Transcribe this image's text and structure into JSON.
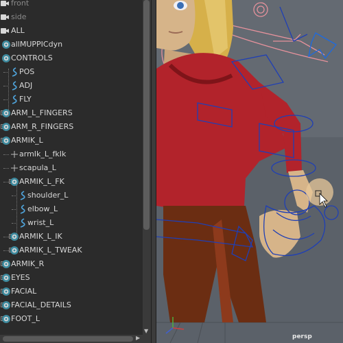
{
  "outliner": {
    "items": [
      {
        "label": "front",
        "icon": "camera-icon",
        "dim": true,
        "expander": ""
      },
      {
        "label": "side",
        "icon": "camera-icon",
        "dim": true,
        "expander": ""
      },
      {
        "label": "ALL",
        "icon": "camera-icon",
        "dim": false,
        "expander": ""
      },
      {
        "label": "allMUPPICdyn",
        "icon": "group-icon",
        "dim": false,
        "expander": ""
      },
      {
        "label": "CONTROLS",
        "icon": "group-icon",
        "dim": false,
        "expander": ""
      },
      {
        "label": "POS",
        "icon": "curve-icon",
        "dim": false,
        "expander": ""
      },
      {
        "label": "ADJ",
        "icon": "curve-icon",
        "dim": false,
        "expander": ""
      },
      {
        "label": "FLY",
        "icon": "curve-icon",
        "dim": false,
        "expander": ""
      },
      {
        "label": "ARM_L_FINGERS",
        "icon": "group-icon",
        "dim": false,
        "expander": "+"
      },
      {
        "label": "ARM_R_FINGERS",
        "icon": "group-icon",
        "dim": false,
        "expander": "+"
      },
      {
        "label": "ARMIK_L",
        "icon": "group-icon",
        "dim": false,
        "expander": "−"
      },
      {
        "label": "armIk_L_fkIk",
        "icon": "locator-icon",
        "dim": false,
        "expander": ""
      },
      {
        "label": "scapula_L",
        "icon": "locator-icon",
        "dim": false,
        "expander": ""
      },
      {
        "label": "ARMIK_L_FK",
        "icon": "group-icon",
        "dim": false,
        "expander": "−"
      },
      {
        "label": "shoulder_L",
        "icon": "curve-icon",
        "dim": false,
        "expander": ""
      },
      {
        "label": "elbow_L",
        "icon": "curve-icon",
        "dim": false,
        "expander": ""
      },
      {
        "label": "wrist_L",
        "icon": "curve-icon",
        "dim": false,
        "expander": ""
      },
      {
        "label": "ARMIK_L_IK",
        "icon": "group-icon",
        "dim": false,
        "expander": "+"
      },
      {
        "label": "ARMIK_L_TWEAK",
        "icon": "group-icon",
        "dim": false,
        "expander": "+"
      },
      {
        "label": "ARMIK_R",
        "icon": "group-icon",
        "dim": false,
        "expander": "+"
      },
      {
        "label": "EYES",
        "icon": "group-icon",
        "dim": false,
        "expander": "+"
      },
      {
        "label": "FACIAL",
        "icon": "group-icon",
        "dim": false,
        "expander": "+"
      },
      {
        "label": "FACIAL_DETAILS",
        "icon": "group-icon",
        "dim": false,
        "expander": "+"
      },
      {
        "label": "FOOT_L",
        "icon": "group-icon",
        "dim": false,
        "expander": "+"
      }
    ]
  },
  "viewport": {
    "camera_label": "persp",
    "colors": {
      "background": "#5a6068",
      "shirt": "#b5232a",
      "pants": "#6b2d12",
      "skin": "#d9b98a",
      "hair": "#d8b24a",
      "control_blue": "#1d3fb5",
      "control_pink": "#e08d98"
    }
  }
}
